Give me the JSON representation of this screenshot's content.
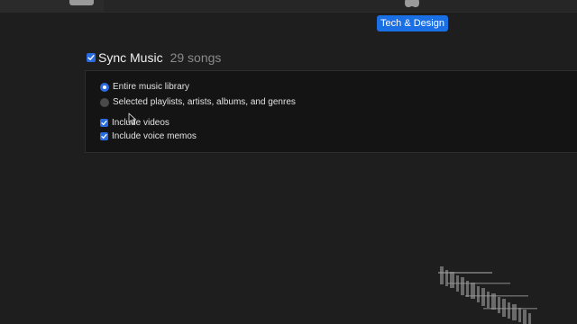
{
  "device": {
    "name": "Tech & Design"
  },
  "sync": {
    "title": "Sync Music",
    "count": "29 songs",
    "enabled": true
  },
  "options": {
    "entire_library": {
      "label": "Entire music library",
      "selected": true
    },
    "selected_items": {
      "label": "Selected playlists, artists, albums, and genres",
      "selected": false
    },
    "include_videos": {
      "label": "Include videos",
      "checked": true
    },
    "include_voice_memos": {
      "label": "Include voice memos",
      "checked": true
    }
  },
  "icons": {
    "device": "iphone-icon",
    "apple": "apple-logo-icon",
    "cursor": "mouse-pointer-icon"
  },
  "colors": {
    "background": "#1e1e1e",
    "panel": "#141414",
    "accent": "#1b6fe4",
    "text": "#e6e6e6",
    "muted": "#8a8a8a"
  }
}
